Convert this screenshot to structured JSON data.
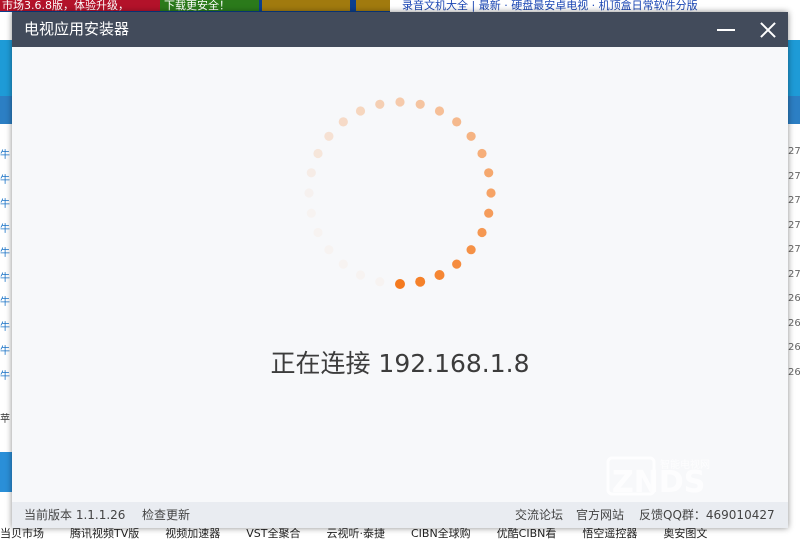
{
  "background_page": {
    "top_left_text": "市场3.6.8版，体验升级，",
    "top_green_text": "下载更安全！",
    "top_right_text": "录音文机大全 | 最新 · 硬盘最安卓电视 · 机顶盒日常软件分版",
    "left_rows": [
      "牛",
      "牛",
      "牛",
      "牛",
      "牛",
      "牛",
      "牛",
      "牛",
      "牛",
      "牛"
    ],
    "right_rows": [
      "27",
      "27",
      "27",
      "27",
      "27",
      "27",
      "26",
      "26",
      "26",
      "26"
    ],
    "bottom_items": [
      "当贝市场",
      "腾讯视频TV版",
      "视频加速器",
      "VST全聚合",
      "云视听·泰捷",
      "CIBN全球购",
      "优酷CIBN看",
      "悟空遥控器",
      "奥安图文"
    ]
  },
  "dialog": {
    "title": "电视应用安装器",
    "minimize_icon": "minimize-icon",
    "close_icon": "close-icon",
    "status_text": "正在连接 192.168.1.8",
    "spinner_color": "#f47a1f",
    "watermark_text": "ZNDS",
    "watermark_sub": "智能电视网",
    "footer": {
      "version_label": "当前版本 1.1.1.26",
      "check_update": "检查更新",
      "forum": "交流论坛",
      "website": "官方网站",
      "qq_group": "反馈QQ群：469010427"
    }
  }
}
